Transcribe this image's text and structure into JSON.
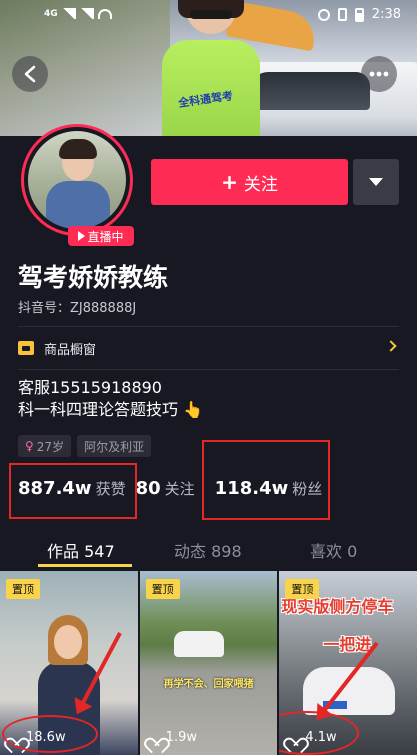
{
  "status_bar": {
    "network": "4G",
    "time": "2:38"
  },
  "banner": {
    "vest_text": "全科通驾考"
  },
  "profile": {
    "live_badge": "直播中",
    "follow_label": "关注",
    "name": "驾考娇娇教练",
    "douyin_id": "抖音号：ZJ888888J",
    "shop_label": "商品橱窗",
    "bio_line1": "客服15515918890",
    "bio_line2": "科一科四理论答题技巧",
    "tags": [
      "27岁",
      "阿尔及利亚"
    ]
  },
  "stats": {
    "likes_num": "887.4w",
    "likes_label": "获赞",
    "following_num": "80",
    "following_label": "关注",
    "followers_num": "118.4w",
    "followers_label": "粉丝"
  },
  "tabs": [
    {
      "label": "作品 547",
      "active": true
    },
    {
      "label": "动态 898",
      "active": false
    },
    {
      "label": "喜欢 0",
      "active": false
    }
  ],
  "videos": [
    {
      "pinned": "置顶",
      "likes": "18.6w",
      "caption": ""
    },
    {
      "pinned": "置顶",
      "likes": "1.9w",
      "caption": "再学不会、回家喂猪"
    },
    {
      "pinned": "置顶",
      "likes": "4.1w",
      "caption": "现实版侧方停车",
      "caption2": "一把进"
    }
  ],
  "colors": {
    "accent": "#fe2c55",
    "background": "#171822",
    "highlight": "#f9d44a",
    "annotation_red": "#e32626"
  }
}
